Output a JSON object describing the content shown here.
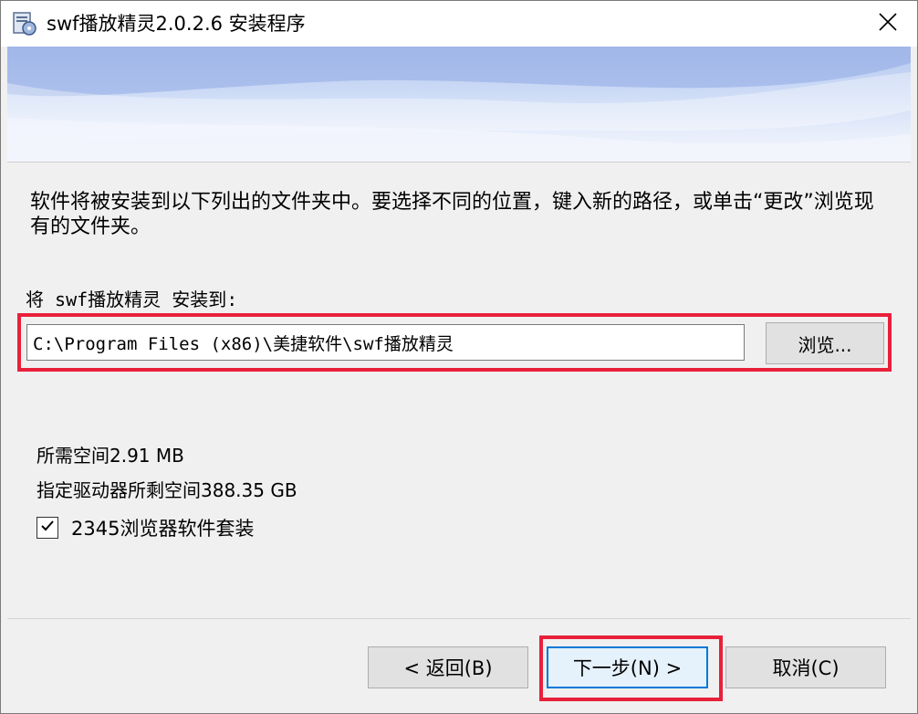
{
  "window": {
    "title": "swf播放精灵2.0.2.6 安装程序",
    "icons": {
      "app": "installer-icon",
      "close": "close-icon"
    }
  },
  "content": {
    "instruction": "软件将被安装到以下列出的文件夹中。要选择不同的位置，键入新的路径，或单击“更改”浏览现有的文件夹。",
    "install_to_label": "将 swf播放精灵 安装到:",
    "install_path": "C:\\Program Files (x86)\\美捷软件\\swf播放精灵",
    "browse_label": "浏览...",
    "required_space": "所需空间2.91 MB",
    "free_space": "指定驱动器所剩空间388.35 GB",
    "bundle_checkbox": {
      "label": "2345浏览器软件套装",
      "checked": true
    }
  },
  "footer": {
    "back_label": "< 返回(B)",
    "next_label": "下一步(N) >",
    "cancel_label": "取消(C)"
  },
  "colors": {
    "highlight": "#e8203a",
    "focus": "#0078d7"
  }
}
